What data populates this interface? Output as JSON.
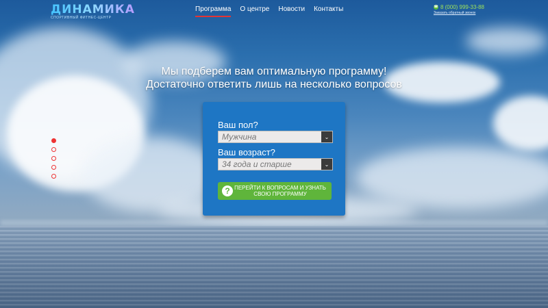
{
  "brand": {
    "name": "ДИНАМИКА",
    "tagline": "СПОРТИВНЫЙ ФИТНЕС-ЦЕНТР"
  },
  "nav": {
    "items": [
      {
        "label": "Программа",
        "active": true
      },
      {
        "label": "О центре",
        "active": false
      },
      {
        "label": "Новости",
        "active": false
      },
      {
        "label": "Контакты",
        "active": false
      }
    ]
  },
  "contact": {
    "phone": "8 (000) 999-33-88",
    "callback": "Заказать обратный звонок"
  },
  "hero": {
    "line1": "Мы подберем вам оптимальную программу!",
    "line2": "Достаточно ответить лишь на несколько вопросов"
  },
  "slider": {
    "count": 5,
    "active_index": 0
  },
  "form": {
    "gender_question": "Ваш пол?",
    "gender_value": "Мужчина",
    "age_question": "Ваш возраст?",
    "age_value": "34 года и старше",
    "submit_label_line1": "ПЕРЕЙТИ К ВОПРОСАМ И УЗНАТЬ",
    "submit_label_line2": "СВОЮ ПРОГРАММУ",
    "submit_icon": "?"
  },
  "colors": {
    "accent_red": "#e43434",
    "panel_blue": "#1e76c4",
    "button_green": "#5fb53b",
    "phone_green": "#9de25a"
  }
}
